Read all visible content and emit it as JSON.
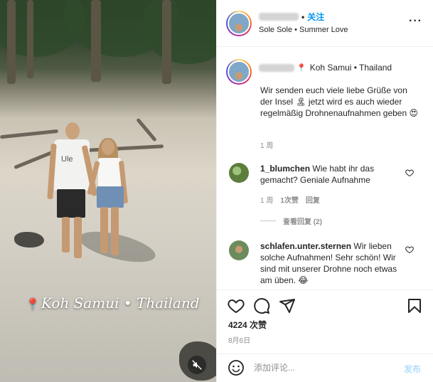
{
  "media": {
    "location_overlay": "Koh Samui • Thailand",
    "shirt_text": "Ule"
  },
  "header": {
    "separator": "•",
    "follow_label": "关注",
    "subtitle": "Sole Sole • Summer Love"
  },
  "caption": {
    "location": "Koh Samui • Thailand",
    "text": "Wir senden euch viele liebe Grüße von der Insel 🏝 jetzt wird es auch wieder regelmäßig Drohnenaufnahmen geben 😍",
    "time": "1 周"
  },
  "comments": [
    {
      "username": "1_blumchen",
      "text": "Wie habt ihr das gemacht? Geniale Aufnahme",
      "time": "1 周",
      "likes": "1次赞",
      "reply_label": "回复",
      "view_replies": "查看回复 (2)"
    },
    {
      "username": "schlafen.unter.sternen",
      "text": "Wir lieben solche Aufnahmen! Sehr schön! Wir sind mit unserer Drohne noch etwas am üben. 😂"
    }
  ],
  "actions": {
    "likes_count": "4224 次赞",
    "date": "8月6日"
  },
  "comment_box": {
    "placeholder": "添加评论...",
    "post_label": "发布"
  },
  "colors": {
    "accent": "#0095f6",
    "post_disabled": "#b2dffc",
    "muted_text": "#8e8e8e"
  }
}
